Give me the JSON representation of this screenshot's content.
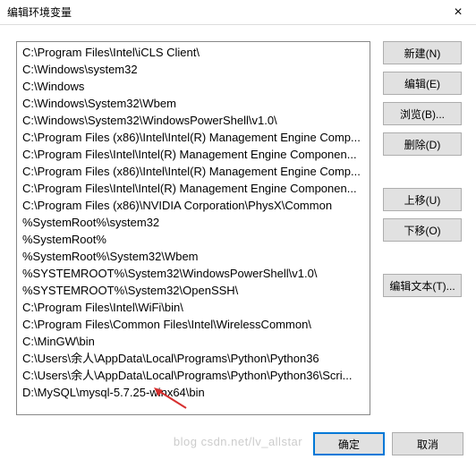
{
  "window": {
    "title": "编辑环境变量",
    "close_label": "×"
  },
  "list": {
    "items": [
      "C:\\Program Files\\Intel\\iCLS Client\\",
      "C:\\Windows\\system32",
      "C:\\Windows",
      "C:\\Windows\\System32\\Wbem",
      "C:\\Windows\\System32\\WindowsPowerShell\\v1.0\\",
      "C:\\Program Files (x86)\\Intel\\Intel(R) Management Engine Comp...",
      "C:\\Program Files\\Intel\\Intel(R) Management Engine Componen...",
      "C:\\Program Files (x86)\\Intel\\Intel(R) Management Engine Comp...",
      "C:\\Program Files\\Intel\\Intel(R) Management Engine Componen...",
      "C:\\Program Files (x86)\\NVIDIA Corporation\\PhysX\\Common",
      "%SystemRoot%\\system32",
      "%SystemRoot%",
      "%SystemRoot%\\System32\\Wbem",
      "%SYSTEMROOT%\\System32\\WindowsPowerShell\\v1.0\\",
      "%SYSTEMROOT%\\System32\\OpenSSH\\",
      "C:\\Program Files\\Intel\\WiFi\\bin\\",
      "C:\\Program Files\\Common Files\\Intel\\WirelessCommon\\",
      "C:\\MinGW\\bin",
      "C:\\Users\\余人\\AppData\\Local\\Programs\\Python\\Python36",
      "C:\\Users\\余人\\AppData\\Local\\Programs\\Python\\Python36\\Scri...",
      "D:\\MySQL\\mysql-5.7.25-winx64\\bin"
    ]
  },
  "buttons": {
    "new": "新建(N)",
    "edit": "编辑(E)",
    "browse": "浏览(B)...",
    "delete": "删除(D)",
    "move_up": "上移(U)",
    "move_down": "下移(O)",
    "edit_text": "编辑文本(T)..."
  },
  "footer": {
    "ok": "确定",
    "cancel": "取消"
  },
  "watermark": "blog csdn.net/lv_allstar"
}
